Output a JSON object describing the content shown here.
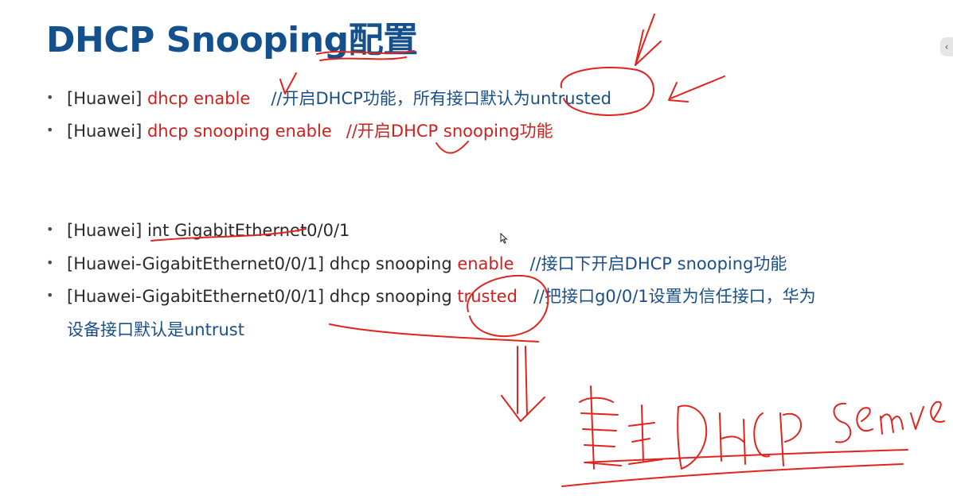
{
  "slide": {
    "title": "DHCP Snooping配置",
    "bullet_glyph": "•",
    "lines": [
      {
        "prefix": "[Huawei] ",
        "cmd": "dhcp enable",
        "comment": "//开启DHCP功能，所有接口默认为untrusted"
      },
      {
        "prefix": "[Huawei] ",
        "cmd": "dhcp snooping enable",
        "comment": "//开启DHCP snooping功能"
      },
      {
        "prefix": "[Huawei] int GigabitEthernet0/0/1"
      },
      {
        "prefix": "[Huawei-GigabitEthernet0/0/1] dhcp snooping ",
        "cmd": "enable",
        "comment": "//接口下开启DHCP snooping功能"
      },
      {
        "prefix": "[Huawei-GigabitEthernet0/0/1] dhcp snooping ",
        "cmd": "trusted",
        "comment": "//把接口g0/0/1设置为信任接口，华为"
      }
    ],
    "continuation": "设备接口默认是untrust"
  },
  "viewer": {
    "side_button_glyph": "‹"
  },
  "colors": {
    "title": "#14508c",
    "command": "#d0201e",
    "comment": "#1b4f88",
    "annotation_ink": "#e3231d"
  },
  "icons": [
    "mouse-cursor-icon",
    "collapse-chevron-icon"
  ]
}
